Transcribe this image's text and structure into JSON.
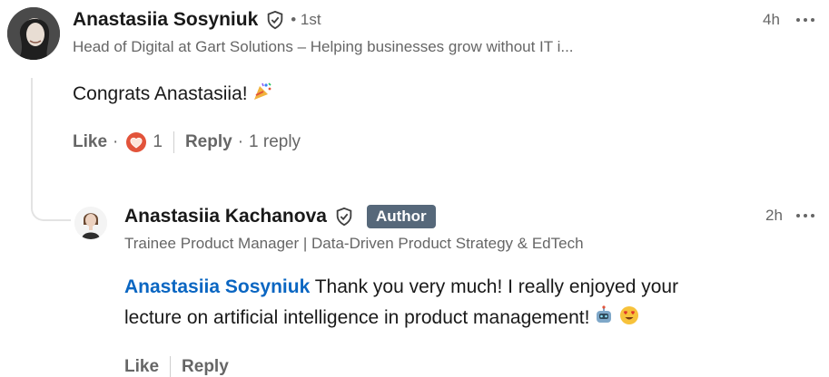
{
  "comment": {
    "author": "Anastasiia Sosyniuk",
    "degree": "• 1st",
    "headline": "Head of Digital at Gart Solutions – Helping businesses grow without IT i...",
    "time": "4h",
    "text": "Congrats Anastasiia!",
    "emoji": "party-popper-icon",
    "actions": {
      "like": "Like",
      "dot": "·",
      "reaction_count": "1",
      "reply": "Reply",
      "reply_count": "1 reply"
    }
  },
  "reply": {
    "author": "Anastasiia Kachanova",
    "badge": "Author",
    "headline": "Trainee Product Manager | Data-Driven Product Strategy & EdTech",
    "time": "2h",
    "mention": "Anastasiia Sosyniuk",
    "text_line1": "Thank you very much! I really enjoyed your",
    "text_line2": "lecture on artificial intelligence in product management!",
    "emojis": [
      "robot-icon",
      "heart-eyes-icon"
    ],
    "actions": {
      "like": "Like",
      "reply": "Reply"
    }
  },
  "colors": {
    "mention": "#0a66c2",
    "badge_bg": "#56687a",
    "secondary_text": "#666666",
    "reaction_heart": "#e2533a"
  }
}
